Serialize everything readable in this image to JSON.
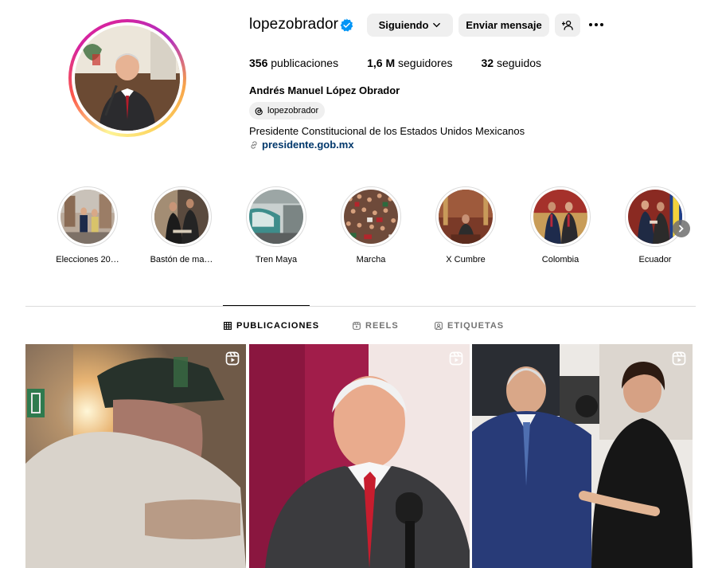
{
  "profile": {
    "username": "lopezobrador",
    "full_name": "Andrés Manuel López Obrador",
    "threads_handle": "lopezobrador",
    "bio": "Presidente Constitucional de los Estados Unidos Mexicanos",
    "link": "presidente.gob.mx",
    "verified_color": "#0095f6"
  },
  "actions": {
    "follow_label": "Siguiendo",
    "message_label": "Enviar mensaje"
  },
  "stats": {
    "posts_count": "356",
    "posts_label": "publicaciones",
    "followers_count": "1,6 M",
    "followers_label": "seguidores",
    "following_count": "32",
    "following_label": "seguidos"
  },
  "highlights": [
    {
      "label": "Elecciones 20…"
    },
    {
      "label": "Bastón de ma…"
    },
    {
      "label": "Tren Maya"
    },
    {
      "label": "Marcha"
    },
    {
      "label": "X Cumbre"
    },
    {
      "label": "Colombia"
    },
    {
      "label": "Ecuador"
    }
  ],
  "tabs": [
    {
      "label": "PUBLICACIONES",
      "icon": "grid-icon",
      "active": true
    },
    {
      "label": "REELS",
      "icon": "reels-icon",
      "active": false
    },
    {
      "label": "ETIQUETAS",
      "icon": "tagged-icon",
      "active": false
    }
  ],
  "posts": [
    {
      "type": "reel",
      "icon": "reel-icon"
    },
    {
      "type": "reel",
      "icon": "reel-icon"
    },
    {
      "type": "reel",
      "icon": "reel-icon"
    }
  ]
}
